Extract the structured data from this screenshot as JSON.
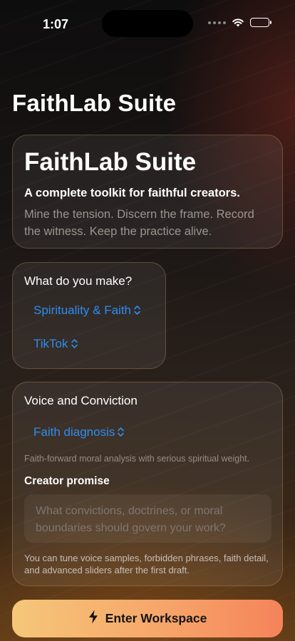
{
  "status_bar": {
    "time": "1:07"
  },
  "page_title": "FaithLab Suite",
  "hero": {
    "title": "FaithLab Suite",
    "subtitle": "A complete toolkit for faithful creators.",
    "description": "Mine the tension. Discern the frame. Record the witness. Keep the practice alive."
  },
  "make": {
    "heading": "What do you make?",
    "category_value": "Spirituality & Faith",
    "platform_value": "TikTok"
  },
  "voice": {
    "heading": "Voice and Conviction",
    "mode_value": "Faith diagnosis",
    "mode_description": "Faith-forward moral analysis with serious spiritual weight.",
    "promise_label": "Creator promise",
    "promise_placeholder": "What convictions, doctrines, or moral boundaries should govern your work?",
    "promise_value": "",
    "note": "You can tune voice samples, forbidden phrases, faith detail, and advanced sliders after the first draft."
  },
  "cta": {
    "label": "Enter Workspace",
    "icon": "lightning-bolt-icon"
  },
  "colors": {
    "accent": "#2f8cf0",
    "cta_start": "#f5c779",
    "cta_end": "#f5835a"
  },
  "icons": {
    "picker_chevron": "chevron-up-down-icon",
    "wifi": "wifi-icon",
    "battery": "battery-icon"
  }
}
